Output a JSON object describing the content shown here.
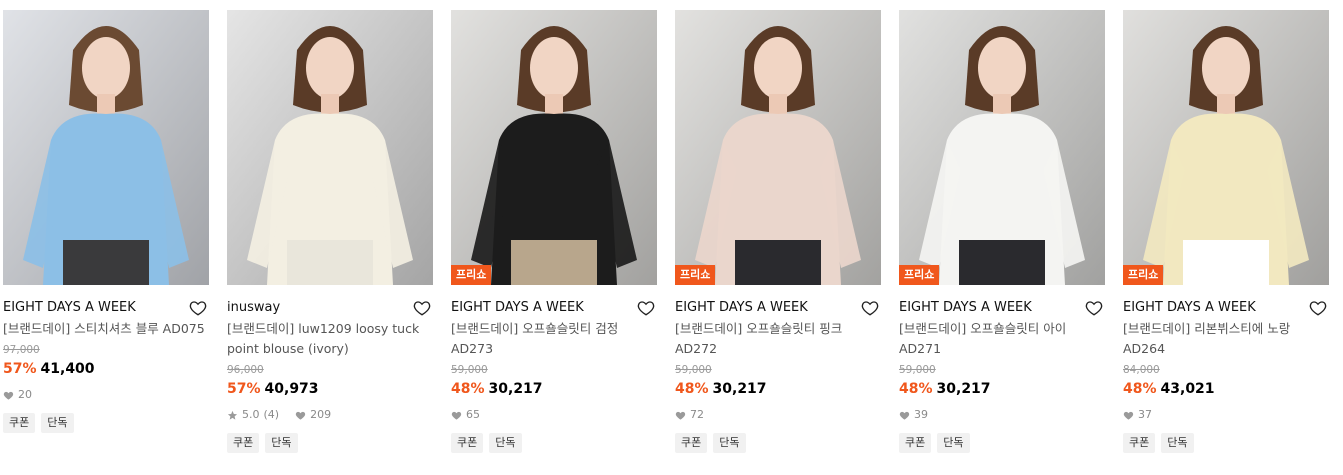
{
  "products": [
    {
      "brand": "EIGHT DAYS A WEEK",
      "name": "[브랜드데이] 스티치셔츠 블루 AD075",
      "original_price": "97,000",
      "discount": "57%",
      "price": "41,400",
      "likes": "20",
      "badge": "",
      "tags": [
        "쿠폰",
        "단독"
      ],
      "colors": {
        "bg": "#d6d9df",
        "garment": "#8cbfe6",
        "bottom": "#3a3a3c"
      }
    },
    {
      "brand": "inusway",
      "name": "[브랜드데이] luw1209 loosy tuck point blouse (ivory)",
      "original_price": "96,000",
      "discount": "57%",
      "price": "40,973",
      "rating": "5.0",
      "reviews": "(4)",
      "likes": "209",
      "badge": "",
      "tags": [
        "쿠폰",
        "단독"
      ],
      "colors": {
        "bg": "#dcdcdc",
        "garment": "#f3efe2",
        "bottom": "#e9e6db"
      }
    },
    {
      "brand": "EIGHT DAYS A WEEK",
      "name": "[브랜드데이] 오프숄슬릿티 검정 AD273",
      "original_price": "59,000",
      "discount": "48%",
      "price": "30,217",
      "likes": "65",
      "badge": "프리쇼",
      "tags": [
        "쿠폰",
        "단독"
      ],
      "colors": {
        "bg": "#d8d7d4",
        "garment": "#1c1c1c",
        "bottom": "#b8a68c"
      }
    },
    {
      "brand": "EIGHT DAYS A WEEK",
      "name": "[브랜드데이] 오프숄슬릿티 핑크 AD272",
      "original_price": "59,000",
      "discount": "48%",
      "price": "30,217",
      "likes": "72",
      "badge": "프리쇼",
      "tags": [
        "쿠폰",
        "단독"
      ],
      "colors": {
        "bg": "#d9d8d5",
        "garment": "#ead6cc",
        "bottom": "#2a2a2e"
      }
    },
    {
      "brand": "EIGHT DAYS A WEEK",
      "name": "[브랜드데이] 오프숄슬릿티 아이 AD271",
      "original_price": "59,000",
      "discount": "48%",
      "price": "30,217",
      "likes": "39",
      "badge": "프리쇼",
      "tags": [
        "쿠폰",
        "단독"
      ],
      "colors": {
        "bg": "#d7d7d5",
        "garment": "#f4f4f2",
        "bottom": "#2a2a2e"
      }
    },
    {
      "brand": "EIGHT DAYS A WEEK",
      "name": "[브랜드데이] 리본뷔스티에 노랑 AD264",
      "original_price": "84,000",
      "discount": "48%",
      "price": "43,021",
      "likes": "37",
      "badge": "프리쇼",
      "tags": [
        "쿠폰",
        "단독"
      ],
      "colors": {
        "bg": "#d6d5d2",
        "garment": "#f2e8c0",
        "bottom": "#ffffff"
      }
    }
  ],
  "icons": {
    "wishlist": "heart-outline-icon",
    "likes": "heart-filled-icon",
    "rating": "star-icon"
  }
}
